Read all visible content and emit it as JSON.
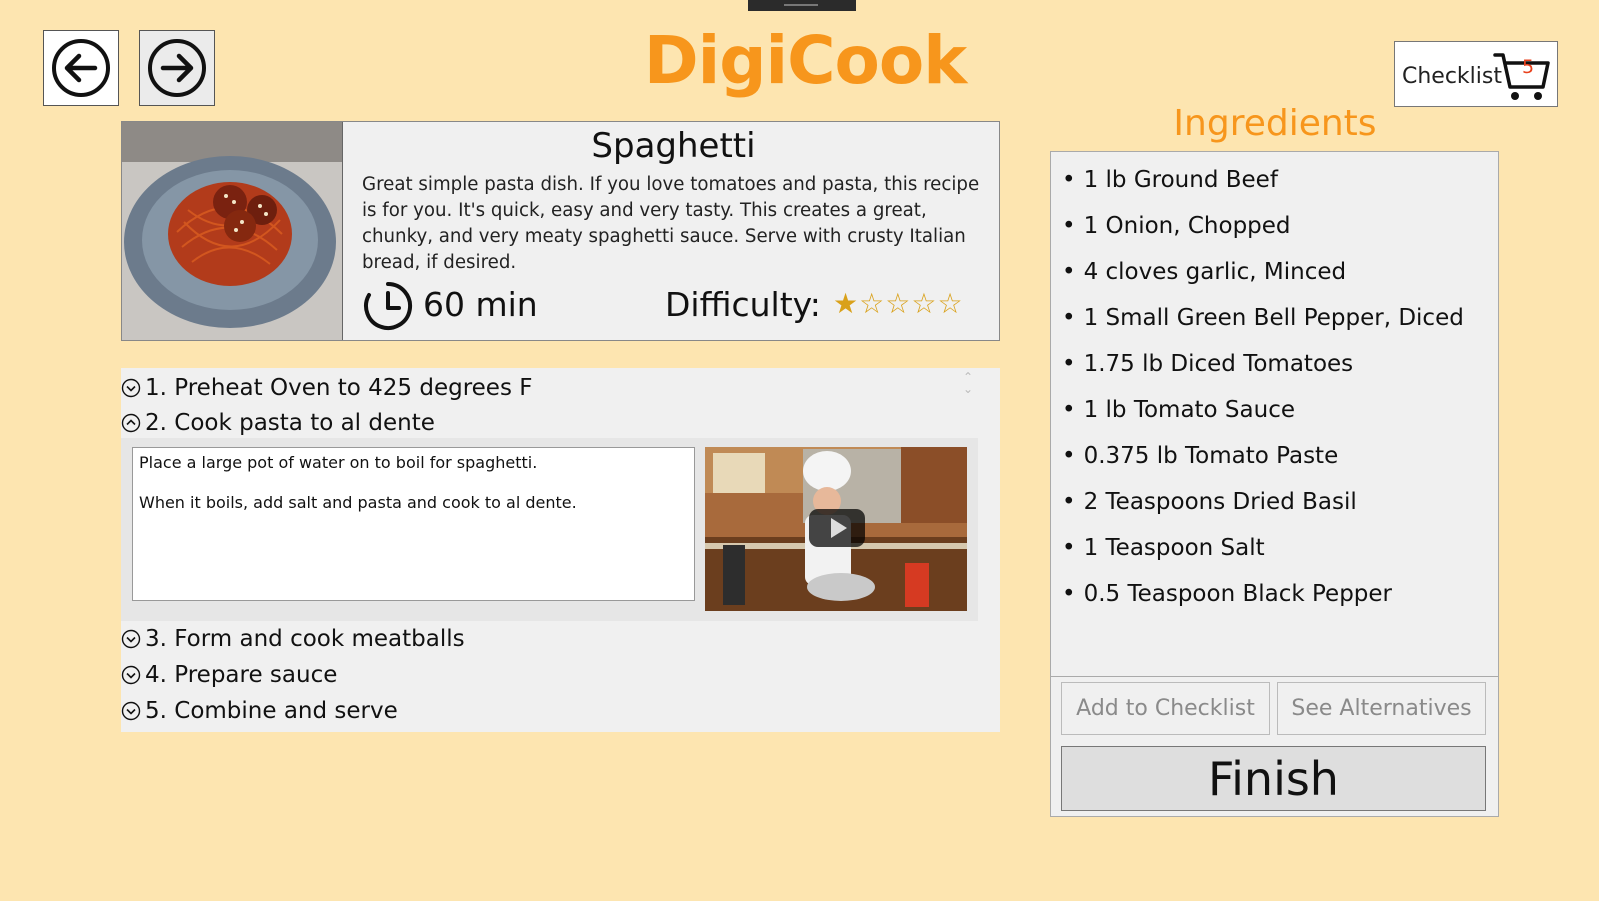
{
  "app": {
    "title": "DigiCook"
  },
  "nav": {
    "back_icon": "arrow-left-circle-icon",
    "forward_icon": "arrow-right-circle-icon"
  },
  "checklist": {
    "label": "Checklist",
    "count": "5",
    "icon": "cart-icon"
  },
  "recipe": {
    "title": "Spaghetti",
    "description": "Great simple pasta dish. If you love tomatoes and pasta, this recipe is for you. It's quick, easy and very tasty. This creates a great, chunky, and very meaty spaghetti sauce. Serve with crusty Italian bread, if desired.",
    "time": "60 min",
    "difficulty_label": "Difficulty:",
    "difficulty_rating": 1,
    "difficulty_max": 5,
    "star_color": "#d9a11a"
  },
  "steps": [
    {
      "label": "1. Preheat Oven to 425 degrees F",
      "expanded": false
    },
    {
      "label": "2. Cook pasta to al dente",
      "expanded": true,
      "details": [
        "Place a large pot of water on to boil for spaghetti.",
        "When it boils, add salt and pasta and cook to al dente."
      ]
    },
    {
      "label": "3. Form and cook meatballs",
      "expanded": false
    },
    {
      "label": "4. Prepare sauce",
      "expanded": false
    },
    {
      "label": "5. Combine and serve",
      "expanded": false
    }
  ],
  "ingredients": {
    "title": "Ingredients",
    "items": [
      "1 lb Ground Beef",
      "1 Onion, Chopped",
      "4 cloves garlic, Minced",
      "1 Small Green Bell Pepper, Diced",
      "1.75 lb Diced Tomatoes",
      "1 lb Tomato Sauce",
      "0.375 lb Tomato Paste",
      "2 Teaspoons Dried Basil",
      "1 Teaspoon Salt",
      "0.5 Teaspoon Black Pepper"
    ],
    "add_label": "Add to Checklist",
    "alternatives_label": "See Alternatives",
    "finish_label": "Finish"
  },
  "colors": {
    "background": "#fde5b0",
    "accent": "#f7961c",
    "badge": "#e8411d"
  }
}
